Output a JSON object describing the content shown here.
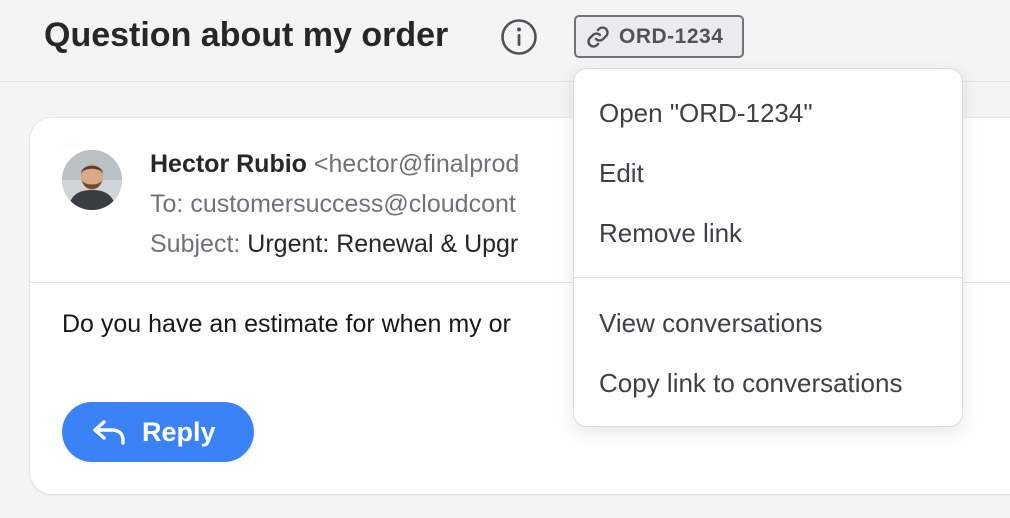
{
  "header": {
    "title": "Question about my order",
    "tag_label": "ORD-1234"
  },
  "email": {
    "sender_name": "Hector Rubio",
    "sender_email": "<hector@finalprod",
    "to_label": "To:",
    "to_value": "customersuccess@cloudcont",
    "subject_label": "Subject:",
    "subject_value": "Urgent: Renewal & Upgr",
    "body": "Do you have an estimate for when my or",
    "reply_label": "Reply"
  },
  "menu": {
    "items": [
      {
        "label": "Open \"ORD-1234\""
      },
      {
        "label": "Edit"
      },
      {
        "label": "Remove link"
      },
      {
        "label": "View conversations"
      },
      {
        "label": "Copy link to conversations"
      }
    ]
  },
  "colors": {
    "accent": "#3b82f6",
    "text_primary": "#27272a",
    "text_muted": "#71717a"
  },
  "icons": [
    "info-icon",
    "link-icon",
    "reply-arrow-icon",
    "avatar-photo"
  ]
}
